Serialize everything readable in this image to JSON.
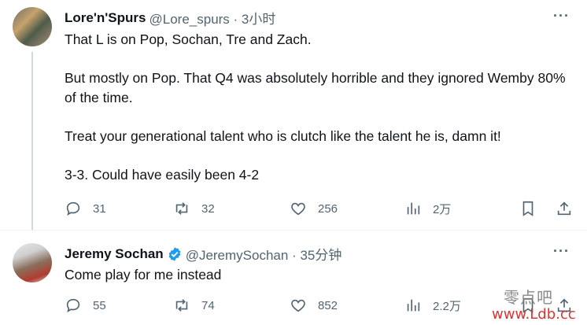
{
  "tweets": [
    {
      "name": "Lore'n'Spurs",
      "handle_time": "@Lore_spurs · 3小时",
      "paragraphs": [
        "That L is on Pop, Sochan, Tre and Zach.",
        "But mostly on Pop. That Q4 was absolutely horrible and they ignored Wemby 80% of the time.",
        "Treat your generational talent who is clutch like the talent he is, damn it!",
        "3-3. Could have easily been 4-2"
      ],
      "replies": "31",
      "retweets": "32",
      "likes": "256",
      "views": "2万"
    },
    {
      "name": "Jeremy Sochan",
      "handle_time": "@JeremySochan · 35分钟",
      "verified": true,
      "paragraphs": [
        "Come play for me instead"
      ],
      "replies": "55",
      "retweets": "74",
      "likes": "852",
      "views": "2.2万"
    }
  ],
  "more_label": "···",
  "watermark": {
    "line1": "零点吧",
    "line2": "www.Ldb.cc"
  },
  "colors": {
    "text": "#0f1419",
    "secondary": "#536471",
    "verified": "#1d9bf0",
    "border": "#eff3f4"
  }
}
